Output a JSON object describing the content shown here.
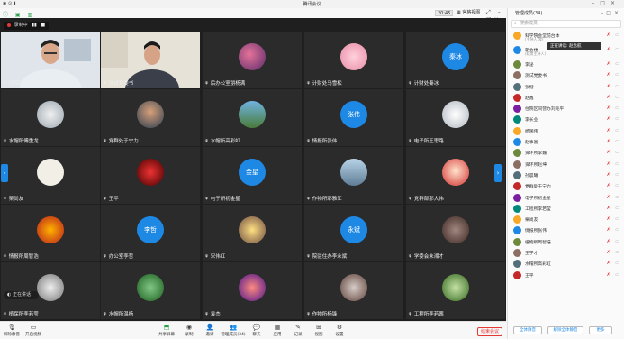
{
  "app_title": "腾讯会议",
  "top_bar": {
    "time": "20:45",
    "gallery_view": "宫格视图"
  },
  "recording": {
    "label": "录制中",
    "pause": "▮▮",
    "stop": "■"
  },
  "speaking": {
    "label": "正在讲话："
  },
  "tiles": [
    [
      "住院区师委刘兆平",
      "测试党委书",
      "后办公室朋杨满",
      "计财处马雪松",
      "计财处秦冰"
    ],
    [
      "水帽所傅重龙",
      "党群处于宁力",
      "水帽所高彩虹",
      "情报所张伟",
      "电子所王思路"
    ],
    [
      "栗尚友",
      "王平",
      "电子所初金星",
      "作物所耶雅江",
      "党群部那大伟"
    ],
    [
      "情报所周智浩",
      "办公室李哲",
      "宋伟红",
      "院驻住办李永斌",
      "学委会朱湘才"
    ],
    [
      "植保所李若莹",
      "水帽所温杨",
      "袁杰",
      "作物所杨锋",
      "工程所李若茜"
    ]
  ],
  "avatar_text": {
    "r0c4": "秦冰",
    "r1c3": "张伟",
    "r2c2": "金星",
    "r3c1": "李哲",
    "r3c3": "永斌"
  },
  "toolbar": {
    "items": [
      "解除静音",
      "开启视频",
      "共享屏幕",
      "录制",
      "邀请",
      "管理成员(34)",
      "聊天",
      "应用",
      "记录",
      "视图",
      "设置"
    ],
    "leave": "结束会议"
  },
  "panel": {
    "title": "管理成员(34)",
    "search_placeholder": "搜索成员",
    "tooltip": "正在讲话: 赵念航",
    "members": [
      {
        "name": "科学院会堂前台体",
        "sub": "(主持人,我)"
      },
      {
        "name": "朝会楼",
        "sub": "(联席主持人)"
      },
      {
        "name": "李泌"
      },
      {
        "name": "测试党委书"
      },
      {
        "name": "张楷"
      },
      {
        "name": "赵鑫"
      },
      {
        "name": "住院区同营办刘兆平"
      },
      {
        "name": "李长业"
      },
      {
        "name": "杨国伟"
      },
      {
        "name": "赵事富"
      },
      {
        "name": "资环所李巍"
      },
      {
        "name": "资环所赵坤"
      },
      {
        "name": "孙晨曦"
      },
      {
        "name": "党群处于宁力"
      },
      {
        "name": "电子所初金星"
      },
      {
        "name": "工程所李若莹"
      },
      {
        "name": "栗尚友"
      },
      {
        "name": "情报所张伟"
      },
      {
        "name": "植物所周智浩"
      },
      {
        "name": "王学才"
      },
      {
        "name": "水帽所高彩虹"
      },
      {
        "name": "王平"
      }
    ],
    "footer_buttons": [
      "全体静音",
      "解除全体静音",
      "更多"
    ]
  },
  "colors": {
    "accent": "#1e88e5",
    "danger": "#e53935",
    "gallery_bg": "#1f1f1f",
    "tile_bg": "#2b2b2b"
  }
}
